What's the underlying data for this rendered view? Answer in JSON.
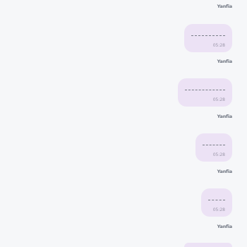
{
  "messages": [
    {
      "sender": "Yanfia",
      "time": "05:28"
    },
    {
      "sender": "Yanfia",
      "time": "05:28"
    },
    {
      "sender": "Yanfia",
      "time": "05:28"
    },
    {
      "sender": "Yanfia",
      "time": "05:28"
    },
    {
      "sender": "Yanfia",
      "time": ""
    }
  ],
  "colors": {
    "background": "#f6f7f9",
    "bubble": "#ece2f5",
    "sender_text": "#6e7480",
    "time_text": "#9a96a8"
  }
}
